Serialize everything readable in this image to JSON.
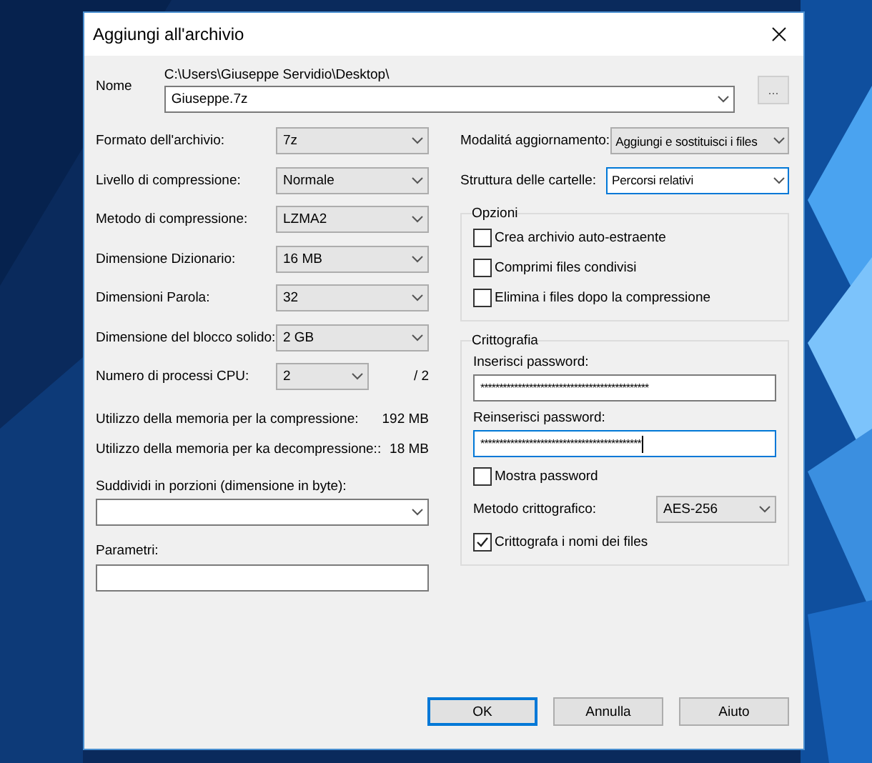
{
  "window": {
    "title": "Aggiungi all'archivio"
  },
  "archive": {
    "label": "Nome",
    "path": "C:\\Users\\Giuseppe Servidio\\Desktop\\",
    "value": "Giuseppe.7z",
    "browse": "..."
  },
  "settings": [
    {
      "label": "Formato dell'archivio:",
      "value": "7z"
    },
    {
      "label": "Livello di compressione:",
      "value": "Normale"
    },
    {
      "label": "Metodo di compressione:",
      "value": "LZMA2"
    },
    {
      "label": "Dimensione Dizionario:",
      "value": "16 MB"
    },
    {
      "label": "Dimensioni Parola:",
      "value": "32"
    },
    {
      "label": "Dimensione del blocco solido:",
      "value": "2 GB"
    },
    {
      "label": "Numero di processi CPU:",
      "value": "2",
      "suffix": "/ 2"
    }
  ],
  "memory": [
    {
      "label": "Utilizzo della memoria per la compressione:",
      "value": "192 MB"
    },
    {
      "label": "Utilizzo della memoria per ka decompressione::",
      "value": "18 MB"
    }
  ],
  "split": {
    "label": "Suddividi in porzioni (dimensione in byte):"
  },
  "params": {
    "label": "Parametri:"
  },
  "right_settings": [
    {
      "label": "Modalitá aggiornamento:",
      "value": "Aggiungi e sostituisci i files",
      "focused": false
    },
    {
      "label": "Struttura delle cartelle:",
      "value": "Percorsi relativi",
      "focused": true
    }
  ],
  "options": {
    "title": "Opzioni",
    "items": [
      {
        "label": "Crea archivio auto-estraente",
        "checked": false
      },
      {
        "label": "Comprimi files condivisi",
        "checked": false
      },
      {
        "label": "Elimina i files dopo la compressione",
        "checked": false
      }
    ]
  },
  "encryption": {
    "title": "Crittografia",
    "fields": [
      {
        "label": "Inserisci password:",
        "value": "*********************************************",
        "focused": false
      },
      {
        "label": "Reinserisci password:",
        "value": "*******************************************",
        "focused": true
      }
    ],
    "show_password": {
      "label": "Mostra password",
      "checked": false
    },
    "method": {
      "label": "Metodo crittografico:",
      "value": "AES-256"
    },
    "encrypt_names": {
      "label": "Crittografa i nomi dei files",
      "checked": true
    }
  },
  "buttons": [
    {
      "label": "OK",
      "default": true
    },
    {
      "label": "Annulla",
      "default": false
    },
    {
      "label": "Aiuto",
      "default": false
    }
  ]
}
